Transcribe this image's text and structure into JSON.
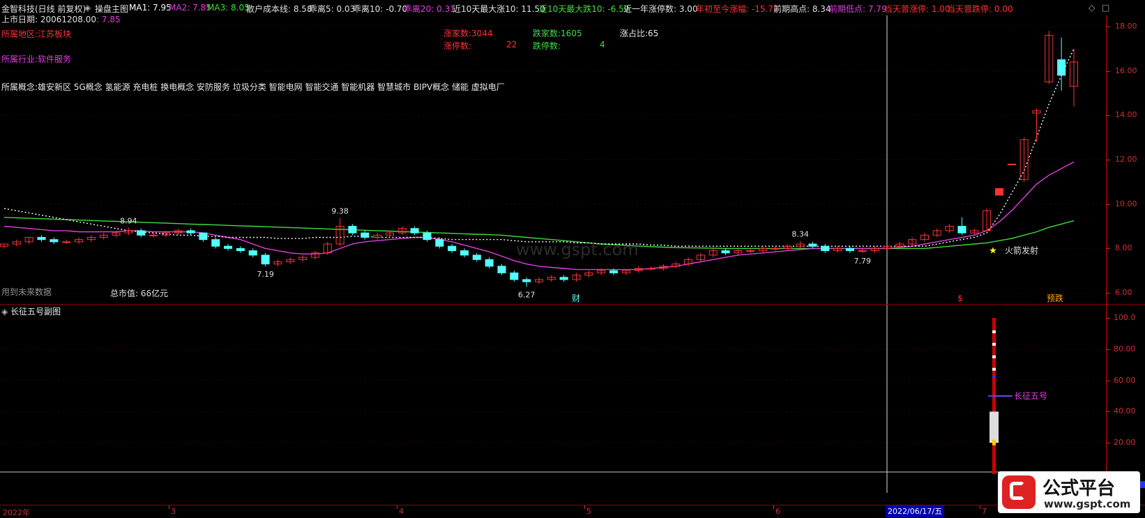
{
  "info_bar": {
    "stock_name": "金智科技(日线 前复权)",
    "indicator_name": "操盘主图",
    "ma1": "MA1: 7.95",
    "ma2": "MA2: 7.85",
    "ma3": "MA3: 8.05",
    "cost_line": "散户成本线: 8.58",
    "bias5": "乖离5: 0.03",
    "bias10": "乖离10: -0.70",
    "bias20": "乖离20: 0.31",
    "max_rise10": "近10天最大涨10: 11.50",
    "max_fall10": "近10天最大跌10: -6.59",
    "limit_up_year": "近一年涨停数: 3.00",
    "ytd_change": "年初至今涨幅: -15.77",
    "prev_high": "前期高点: 8.34",
    "prev_low": "前期低点: 7.79",
    "day_limit_up": "当天曾涨停: 1.00",
    "day_limit_down": "当天曾跌停: 0.00"
  },
  "main_panel": {
    "listing_date_label": "上市日期: 20061208.00",
    "listing_extra": ": 7.85",
    "region": "所属地区:江苏板块",
    "industry": "所属行业:软件服务",
    "concepts": "所属概念:雄安新区 5G概念 氢能源 充电桩 换电概念 安防服务 垃圾分类 智能电网 智能交通 智能机器 智慧城市 BIPV概念 储能 虚拟电厂",
    "up_count": "涨家数:3044",
    "down_count": "跌家数:1605",
    "up_ratio": "涨占比:65",
    "limit_up_label": "涨停数:",
    "limit_up_value": "22",
    "limit_down_label": "跌停数:",
    "limit_down_value": "4",
    "future_data": "用到未来数据",
    "market_cap": "总市值: 66亿元",
    "rocket_label": "火箭发射",
    "watermark": "www.gspt.com",
    "price_labels": [
      "8.94",
      "9.38",
      "7.19",
      "6.27",
      "8.34",
      "7.79"
    ],
    "bottom_marks": [
      "财",
      "$",
      "预跌"
    ]
  },
  "sub_panel": {
    "title": "长征五号副图",
    "line_label": "长征五号",
    "y_labels": [
      "100.0",
      "80.00",
      "60.00",
      "40.00",
      "20.00"
    ]
  },
  "main_y_labels": [
    "18.00",
    "16.00",
    "14.00",
    "12.00",
    "10.00",
    "8.00",
    "6.00"
  ],
  "x_axis": {
    "labels": [
      "2022年",
      "3",
      "4",
      "5",
      "6",
      "7"
    ],
    "cursor_date": "2022/06/17/五"
  },
  "brand": {
    "logo_text": "公式平台",
    "logo_url_text": "www.gspt.com"
  },
  "colors": {
    "up": "#ff3333",
    "down": "#54ffff",
    "ma1": "#ffffff",
    "ma2": "#e040e0",
    "ma3": "#40dd40",
    "axis": "#cc0000"
  },
  "chart_data": {
    "type": "candlestick",
    "ylim": [
      5.5,
      18.5
    ],
    "candles": [
      [
        8.1,
        8.2,
        8.0,
        8.2
      ],
      [
        8.2,
        8.4,
        8.1,
        8.3
      ],
      [
        8.3,
        8.5,
        8.2,
        8.5
      ],
      [
        8.5,
        8.6,
        8.3,
        8.4
      ],
      [
        8.4,
        8.5,
        8.2,
        8.3
      ],
      [
        8.3,
        8.4,
        8.2,
        8.3
      ],
      [
        8.3,
        8.5,
        8.2,
        8.4
      ],
      [
        8.4,
        8.6,
        8.3,
        8.5
      ],
      [
        8.5,
        8.7,
        8.4,
        8.6
      ],
      [
        8.6,
        8.8,
        8.5,
        8.7
      ],
      [
        8.7,
        8.94,
        8.6,
        8.8
      ],
      [
        8.8,
        8.9,
        8.5,
        8.6
      ],
      [
        8.6,
        8.7,
        8.5,
        8.6
      ],
      [
        8.6,
        8.8,
        8.5,
        8.7
      ],
      [
        8.7,
        8.9,
        8.6,
        8.8
      ],
      [
        8.8,
        8.9,
        8.6,
        8.7
      ],
      [
        8.7,
        8.7,
        8.3,
        8.4
      ],
      [
        8.4,
        8.5,
        8.0,
        8.1
      ],
      [
        8.1,
        8.2,
        7.9,
        8.0
      ],
      [
        8.0,
        8.1,
        7.8,
        7.9
      ],
      [
        7.9,
        8.0,
        7.6,
        7.7
      ],
      [
        7.7,
        7.8,
        7.19,
        7.3
      ],
      [
        7.3,
        7.5,
        7.2,
        7.4
      ],
      [
        7.4,
        7.6,
        7.3,
        7.5
      ],
      [
        7.5,
        7.7,
        7.4,
        7.6
      ],
      [
        7.6,
        7.9,
        7.5,
        7.8
      ],
      [
        7.8,
        8.3,
        7.7,
        8.2
      ],
      [
        8.2,
        9.38,
        8.1,
        9.0
      ],
      [
        9.0,
        9.1,
        8.6,
        8.7
      ],
      [
        8.7,
        8.8,
        8.4,
        8.5
      ],
      [
        8.5,
        8.7,
        8.4,
        8.6
      ],
      [
        8.6,
        8.8,
        8.5,
        8.7
      ],
      [
        8.7,
        9.0,
        8.6,
        8.9
      ],
      [
        8.9,
        9.0,
        8.6,
        8.7
      ],
      [
        8.7,
        8.8,
        8.3,
        8.4
      ],
      [
        8.4,
        8.5,
        8.0,
        8.1
      ],
      [
        8.1,
        8.2,
        7.8,
        7.9
      ],
      [
        7.9,
        8.0,
        7.6,
        7.7
      ],
      [
        7.7,
        7.8,
        7.4,
        7.5
      ],
      [
        7.5,
        7.6,
        7.1,
        7.2
      ],
      [
        7.2,
        7.3,
        6.8,
        6.9
      ],
      [
        6.9,
        7.0,
        6.5,
        6.6
      ],
      [
        6.6,
        6.7,
        6.27,
        6.5
      ],
      [
        6.5,
        6.7,
        6.4,
        6.6
      ],
      [
        6.6,
        6.8,
        6.5,
        6.7
      ],
      [
        6.7,
        6.8,
        6.5,
        6.6
      ],
      [
        6.6,
        6.9,
        6.5,
        6.8
      ],
      [
        6.8,
        7.0,
        6.7,
        6.9
      ],
      [
        6.9,
        7.1,
        6.8,
        7.0
      ],
      [
        7.0,
        7.1,
        6.8,
        6.9
      ],
      [
        6.9,
        7.0,
        6.8,
        7.0
      ],
      [
        7.0,
        7.2,
        6.9,
        7.1
      ],
      [
        7.1,
        7.2,
        7.0,
        7.1
      ],
      [
        7.1,
        7.3,
        7.0,
        7.2
      ],
      [
        7.2,
        7.4,
        7.1,
        7.3
      ],
      [
        7.3,
        7.6,
        7.2,
        7.5
      ],
      [
        7.5,
        7.8,
        7.4,
        7.7
      ],
      [
        7.7,
        8.0,
        7.6,
        7.9
      ],
      [
        7.9,
        8.0,
        7.7,
        7.8
      ],
      [
        7.8,
        8.0,
        7.7,
        7.9
      ],
      [
        7.9,
        8.0,
        7.8,
        7.9
      ],
      [
        7.9,
        8.1,
        7.8,
        8.0
      ],
      [
        8.0,
        8.1,
        7.9,
        8.0
      ],
      [
        8.0,
        8.2,
        7.9,
        8.1
      ],
      [
        8.1,
        8.34,
        8.0,
        8.2
      ],
      [
        8.2,
        8.3,
        8.0,
        8.1
      ],
      [
        8.1,
        8.2,
        7.8,
        7.9
      ],
      [
        7.9,
        8.1,
        7.8,
        8.0
      ],
      [
        8.0,
        8.1,
        7.8,
        7.9
      ],
      [
        7.9,
        8.0,
        7.79,
        7.9
      ],
      [
        7.9,
        8.1,
        7.8,
        8.0
      ],
      [
        8.0,
        8.2,
        7.9,
        8.1
      ],
      [
        8.1,
        8.3,
        8.0,
        8.2
      ],
      [
        8.2,
        8.5,
        8.1,
        8.4
      ],
      [
        8.4,
        8.7,
        8.3,
        8.6
      ],
      [
        8.6,
        8.9,
        8.5,
        8.8
      ],
      [
        8.8,
        9.1,
        8.7,
        9.0
      ],
      [
        9.0,
        9.4,
        8.6,
        8.7
      ],
      [
        8.7,
        8.9,
        8.6,
        8.8
      ],
      [
        8.8,
        9.8,
        8.8,
        9.7
      ],
      [
        10.4,
        10.7,
        10.4,
        10.7
      ],
      [
        11.8,
        11.8,
        11.8,
        11.8
      ],
      [
        11.1,
        13.0,
        11.0,
        12.9
      ],
      [
        14.1,
        14.3,
        12.8,
        14.2
      ],
      [
        15.5,
        17.8,
        15.4,
        17.6
      ],
      [
        16.5,
        17.5,
        15.1,
        15.8
      ],
      [
        15.3,
        17.0,
        14.4,
        16.4
      ]
    ],
    "ma_cost": [
      9.8,
      9.7,
      9.6,
      9.5,
      9.4,
      9.3,
      9.2,
      9.1,
      9.0,
      8.9,
      8.8,
      8.75,
      8.7,
      8.65,
      8.6,
      8.6,
      8.55,
      8.55,
      8.5,
      8.5,
      8.5,
      8.5,
      8.45,
      8.45,
      8.45,
      8.5,
      8.5,
      8.5,
      8.55,
      8.55,
      8.5,
      8.5,
      8.5,
      8.5,
      8.5,
      8.45,
      8.4,
      8.4,
      8.4,
      8.4,
      8.4,
      8.35,
      8.3,
      8.3,
      8.3,
      8.3,
      8.25,
      8.25,
      8.2,
      8.2,
      8.2,
      8.2,
      8.15,
      8.15,
      8.1,
      8.1,
      8.1,
      8.1,
      8.1,
      8.1,
      8.1,
      8.1,
      8.1,
      8.1,
      8.1,
      8.1,
      8.1,
      8.1,
      8.1,
      8.1,
      8.1,
      8.1,
      8.1,
      8.1,
      8.1,
      8.2,
      8.3,
      8.4,
      8.5,
      8.7,
      9.5,
      10.5,
      11.5,
      13.0,
      14.5,
      15.8,
      17.0
    ],
    "ma2_line": [
      9.0,
      8.95,
      8.9,
      8.85,
      8.8,
      8.8,
      8.75,
      8.75,
      8.75,
      8.75,
      8.8,
      8.8,
      8.75,
      8.75,
      8.75,
      8.75,
      8.7,
      8.6,
      8.5,
      8.4,
      8.2,
      8.0,
      7.9,
      7.8,
      7.75,
      7.75,
      7.8,
      8.0,
      8.2,
      8.3,
      8.35,
      8.4,
      8.45,
      8.5,
      8.5,
      8.4,
      8.3,
      8.15,
      8.0,
      7.85,
      7.65,
      7.45,
      7.3,
      7.2,
      7.15,
      7.1,
      7.05,
      7.05,
      7.05,
      7.05,
      7.05,
      7.05,
      7.1,
      7.15,
      7.2,
      7.3,
      7.4,
      7.5,
      7.6,
      7.7,
      7.75,
      7.8,
      7.85,
      7.9,
      7.95,
      8.0,
      8.0,
      8.0,
      8.0,
      8.0,
      8.0,
      8.0,
      8.05,
      8.1,
      8.2,
      8.3,
      8.4,
      8.5,
      8.6,
      8.8,
      9.2,
      9.7,
      10.3,
      10.9,
      11.3,
      11.6,
      11.9
    ],
    "ma3_line": [
      9.4,
      9.38,
      9.36,
      9.34,
      9.32,
      9.3,
      9.28,
      9.26,
      9.24,
      9.22,
      9.2,
      9.18,
      9.16,
      9.14,
      9.12,
      9.1,
      9.08,
      9.06,
      9.04,
      9.02,
      9.0,
      8.98,
      8.96,
      8.94,
      8.92,
      8.9,
      8.88,
      8.86,
      8.84,
      8.82,
      8.8,
      8.78,
      8.76,
      8.74,
      8.72,
      8.7,
      8.68,
      8.66,
      8.64,
      8.62,
      8.6,
      8.55,
      8.5,
      8.45,
      8.4,
      8.35,
      8.3,
      8.25,
      8.2,
      8.17,
      8.14,
      8.11,
      8.08,
      8.06,
      8.04,
      8.03,
      8.02,
      8.01,
      8.0,
      8.0,
      8.0,
      8.0,
      8.0,
      8.0,
      8.0,
      8.0,
      8.0,
      8.0,
      8.0,
      8.0,
      8.0,
      8.0,
      8.0,
      8.0,
      8.0,
      8.05,
      8.1,
      8.15,
      8.2,
      8.25,
      8.35,
      8.45,
      8.6,
      8.75,
      8.95,
      9.1,
      9.25
    ]
  }
}
